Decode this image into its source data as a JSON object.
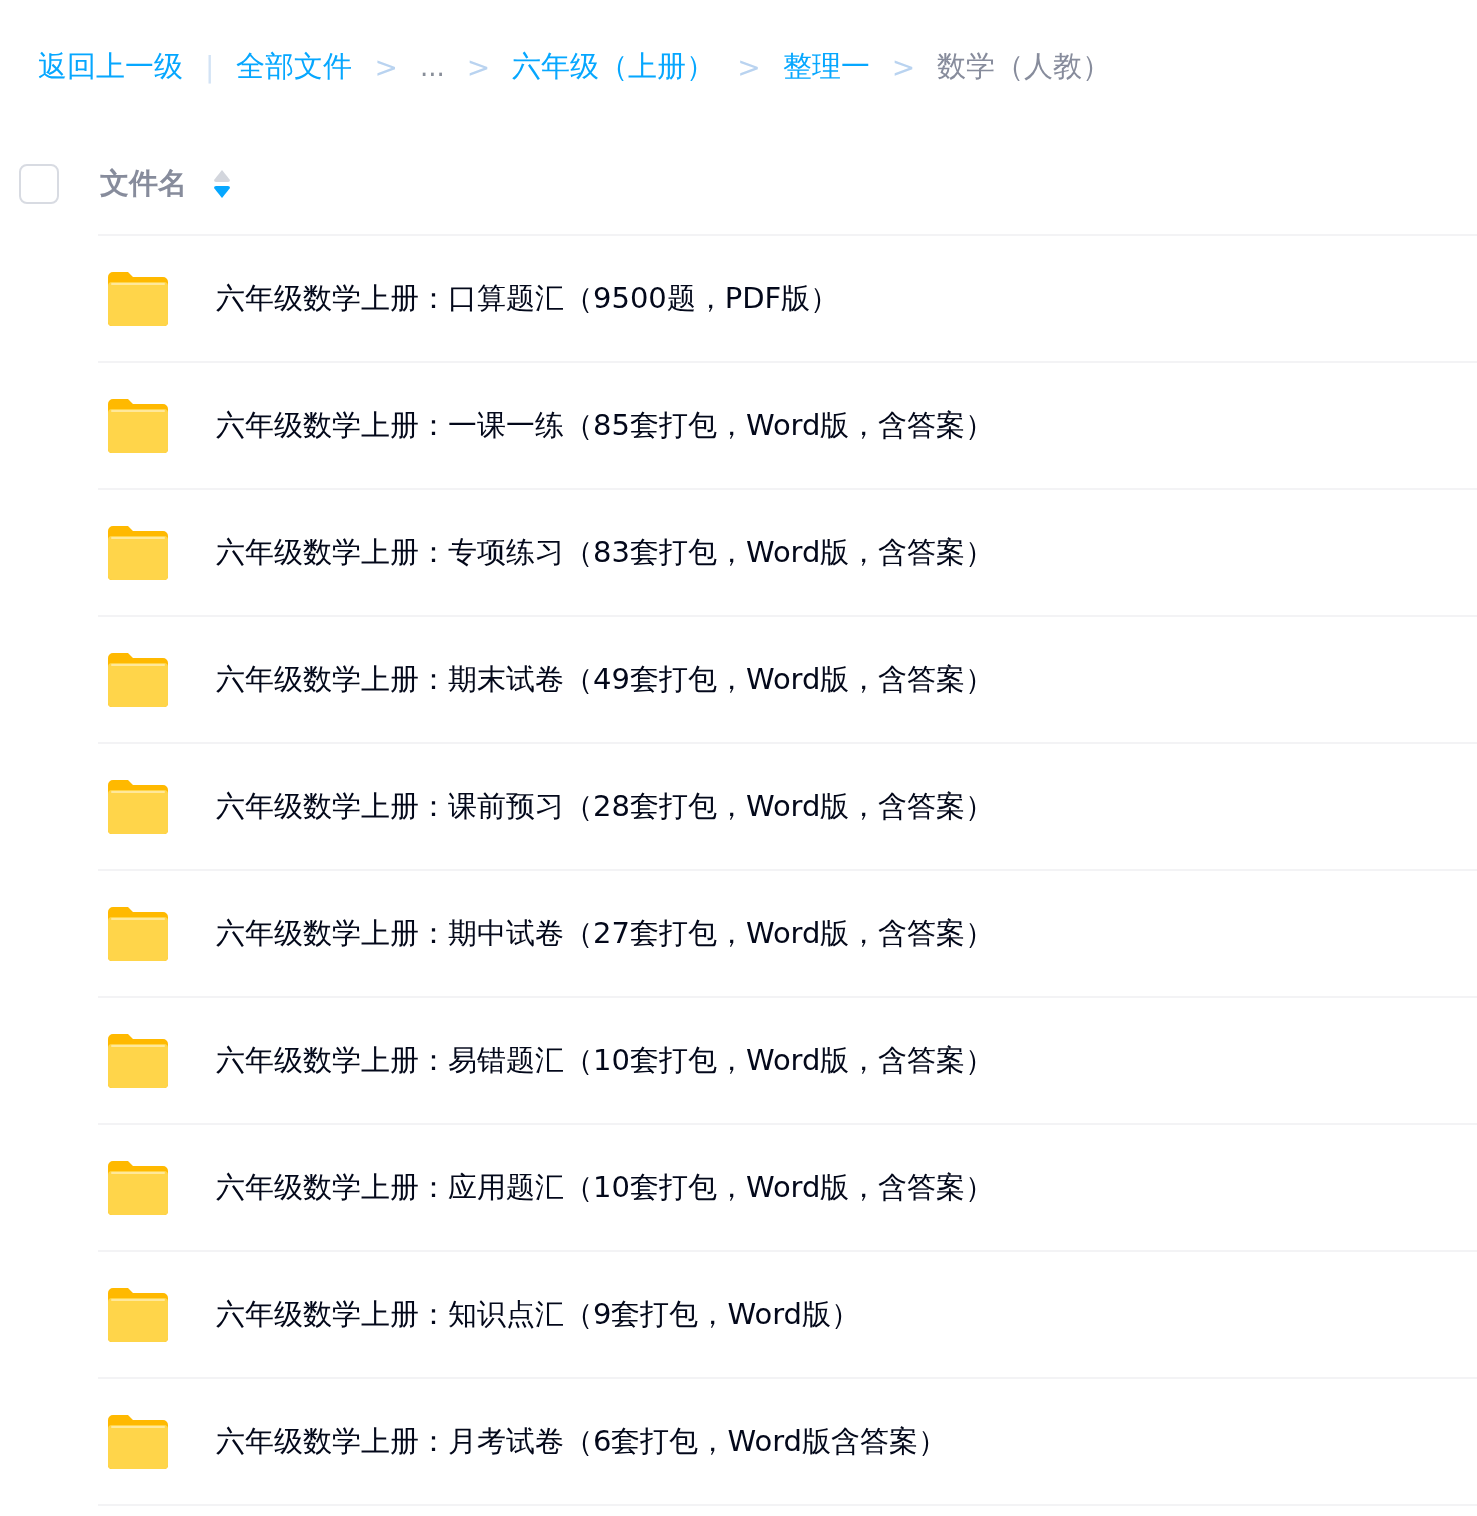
{
  "breadcrumb": [
    {
      "kind": "link",
      "text": "返回上一级"
    },
    {
      "kind": "divider",
      "text": "|"
    },
    {
      "kind": "link",
      "text": "全部文件"
    },
    {
      "kind": "chevron",
      "text": ">"
    },
    {
      "kind": "ellipsis",
      "text": "..."
    },
    {
      "kind": "chevron",
      "text": ">"
    },
    {
      "kind": "link",
      "text": "六年级（上册）"
    },
    {
      "kind": "chevron",
      "text": ">"
    },
    {
      "kind": "link",
      "text": "整理一"
    },
    {
      "kind": "chevron",
      "text": ">"
    },
    {
      "kind": "current",
      "text": "数学（人教）"
    }
  ],
  "header": {
    "checked": false,
    "column": "文件名",
    "sort_descending": true
  },
  "files": [
    {
      "name": "六年级数学上册：口算题汇（9500题，PDF版）"
    },
    {
      "name": "六年级数学上册：一课一练（85套打包，Word版，含答案）"
    },
    {
      "name": "六年级数学上册：专项练习（83套打包，Word版，含答案）"
    },
    {
      "name": "六年级数学上册：期末试卷（49套打包，Word版，含答案）"
    },
    {
      "name": "六年级数学上册：课前预习（28套打包，Word版，含答案）"
    },
    {
      "name": "六年级数学上册：期中试卷（27套打包，Word版，含答案）"
    },
    {
      "name": "六年级数学上册：易错题汇（10套打包，Word版，含答案）"
    },
    {
      "name": "六年级数学上册：应用题汇（10套打包，Word版，含答案）"
    },
    {
      "name": "六年级数学上册：知识点汇（9套打包，Word版）"
    },
    {
      "name": "六年级数学上册：月考试卷（6套打包，Word版含答案）"
    }
  ]
}
